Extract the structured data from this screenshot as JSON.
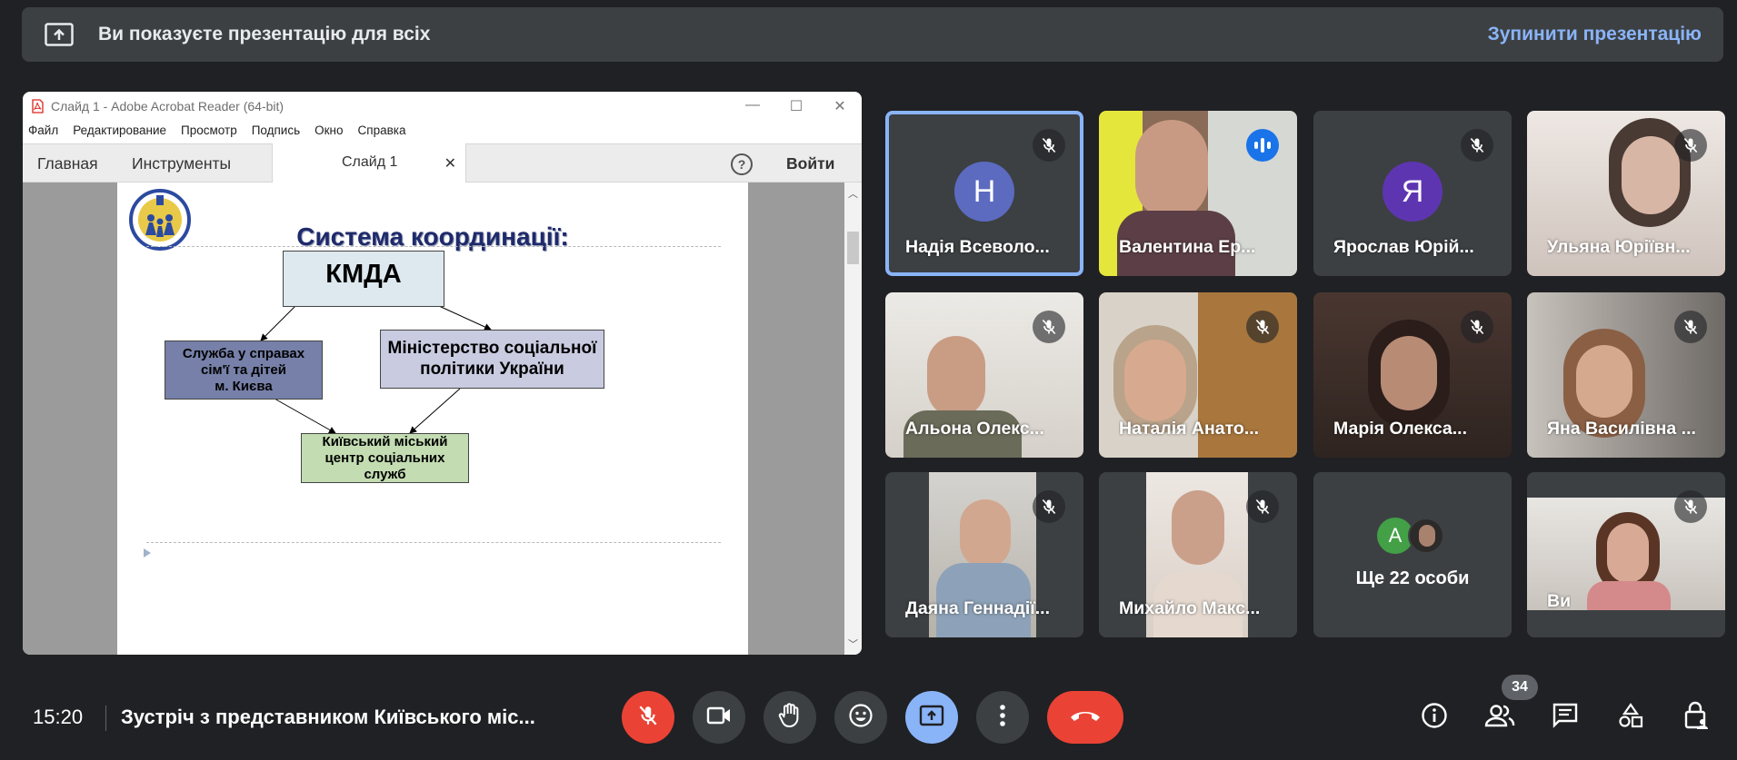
{
  "banner": {
    "text": "Ви показуєте презентацію для всіх",
    "stop_label": "Зупинити презентацію"
  },
  "acrobat": {
    "window_title": "Слайд 1 - Adobe Acrobat Reader (64-bit)",
    "menu": [
      "Файл",
      "Редактирование",
      "Просмотр",
      "Подпись",
      "Окно",
      "Справка"
    ],
    "tabs": {
      "home": "Главная",
      "tools": "Инструменты",
      "document": "Слайд 1"
    },
    "help_symbol": "?",
    "login_label": "Войти"
  },
  "slide": {
    "title": "Система координації:",
    "boxes": {
      "kmda": "КМДА",
      "service": "Служба  у справах\nсім'ї  та дітей\nм. Києва",
      "ministry": "Міністерство соціальної\nполітики України",
      "center": "Київський  міський\nцентр соціальних\nслужб"
    },
    "colors": {
      "kmda": "#dde9ee",
      "service": "#7680a8",
      "ministry": "#c9cbe0",
      "center": "#c3dcb2",
      "title": "#1f2a6b"
    }
  },
  "participants": [
    {
      "name": "Надія Всеволо...",
      "avatar": "Н",
      "avatar_color": "#5c6bc0",
      "mic": "muted",
      "active": true
    },
    {
      "name": "Валентина Ер...",
      "mic": "speaking"
    },
    {
      "name": "Ярослав Юрій...",
      "avatar": "Я",
      "avatar_color": "#5e35b1",
      "mic": "muted"
    },
    {
      "name": "Ульяна Юріївн...",
      "mic": "muted"
    },
    {
      "name": "Альона Олекс...",
      "mic": "muted"
    },
    {
      "name": "Наталія Анато...",
      "mic": "muted"
    },
    {
      "name": "Марія Олекса...",
      "mic": "muted"
    },
    {
      "name": "Яна Василівна ...",
      "mic": "muted"
    },
    {
      "name": "Даяна Геннадії...",
      "mic": "muted"
    },
    {
      "name": "Михайло Макс...",
      "mic": "muted"
    },
    {
      "name": "Ще 22 особи",
      "avatar": "А",
      "avatar_color": "#43a047"
    },
    {
      "name": "Ви",
      "mic": "muted"
    }
  ],
  "bottom": {
    "time": "15:20",
    "meeting_title": "Зустріч з представником Київського міс...",
    "participants_count": "34"
  },
  "colors": {
    "background": "#202124",
    "panel": "#3c4043",
    "accent": "#8ab4f8",
    "danger": "#ea4335"
  }
}
